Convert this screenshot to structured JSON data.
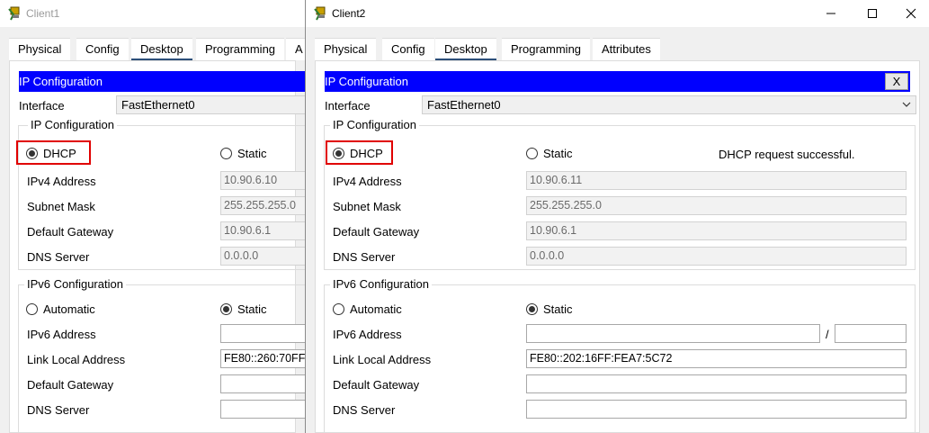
{
  "win1": {
    "title": "Client1",
    "tabs": [
      "Physical",
      "Config",
      "Desktop",
      "Programming",
      "A"
    ],
    "ipconfig": {
      "header": "IP Configuration",
      "interface_label": "Interface",
      "interface_value": "FastEthernet0",
      "ipv4_group": "IP Configuration",
      "dhcp": "DHCP",
      "static": "Static",
      "ipv4_label": "IPv4 Address",
      "ipv4_value": "10.90.6.10",
      "subnet_label": "Subnet Mask",
      "subnet_value": "255.255.255.0",
      "gw_label": "Default Gateway",
      "gw_value": "10.90.6.1",
      "dns_label": "DNS Server",
      "dns_value": "0.0.0.0",
      "ipv6_group": "IPv6 Configuration",
      "automatic": "Automatic",
      "static6": "Static",
      "ipv6_label": "IPv6 Address",
      "ipv6_value": "",
      "lla_label": "Link Local Address",
      "lla_value": "FE80::260:70FF",
      "gw6_label": "Default Gateway",
      "gw6_value": "",
      "dns6_label": "DNS Server",
      "dns6_value": ""
    }
  },
  "win2": {
    "title": "Client2",
    "tabs": [
      "Physical",
      "Config",
      "Desktop",
      "Programming",
      "Attributes"
    ],
    "ipconfig": {
      "header": "IP Configuration",
      "close": "X",
      "interface_label": "Interface",
      "interface_value": "FastEthernet0",
      "ipv4_group": "IP Configuration",
      "dhcp": "DHCP",
      "static": "Static",
      "status": "DHCP request successful.",
      "ipv4_label": "IPv4 Address",
      "ipv4_value": "10.90.6.11",
      "subnet_label": "Subnet Mask",
      "subnet_value": "255.255.255.0",
      "gw_label": "Default Gateway",
      "gw_value": "10.90.6.1",
      "dns_label": "DNS Server",
      "dns_value": "0.0.0.0",
      "ipv6_group": "IPv6 Configuration",
      "automatic": "Automatic",
      "static6": "Static",
      "ipv6_label": "IPv6 Address",
      "ipv6_value": "",
      "prefix_sep": "/",
      "prefix_value": "",
      "lla_label": "Link Local Address",
      "lla_value": "FE80::202:16FF:FEA7:5C72",
      "gw6_label": "Default Gateway",
      "gw6_value": "",
      "dns6_label": "DNS Server",
      "dns6_value": ""
    }
  },
  "icons": {
    "app": "packet-tracer-pc-icon",
    "minimize": "minimize-icon",
    "maximize": "maximize-icon",
    "close": "close-icon",
    "dropdown": "chevron-down-icon"
  },
  "colors": {
    "header_blue": "#0000ff",
    "highlight_red": "#e00000",
    "active_tab_underline": "#2c4f7a"
  }
}
